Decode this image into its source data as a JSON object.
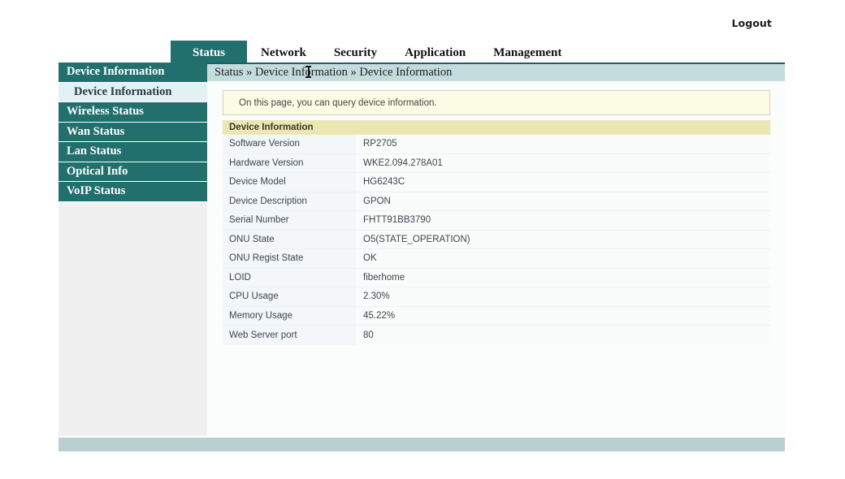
{
  "page": {
    "title": "Device Information",
    "logout_label": "Logout"
  },
  "nav": {
    "tabs": [
      {
        "label": "Status",
        "active": true
      },
      {
        "label": "Network",
        "active": false
      },
      {
        "label": "Security",
        "active": false
      },
      {
        "label": "Application",
        "active": false
      },
      {
        "label": "Management",
        "active": false
      }
    ]
  },
  "sidebar": {
    "items": [
      {
        "label": "Device Information",
        "type": "group",
        "active": false
      },
      {
        "label": "Device Information",
        "type": "sub",
        "active": true
      },
      {
        "label": "Wireless Status",
        "type": "group",
        "active": false
      },
      {
        "label": "Wan Status",
        "type": "group",
        "active": false
      },
      {
        "label": "Lan Status",
        "type": "group",
        "active": false
      },
      {
        "label": "Optical Info",
        "type": "group",
        "active": false
      },
      {
        "label": "VoIP Status",
        "type": "group",
        "active": false
      }
    ]
  },
  "breadcrumb": {
    "text": "Status » Device Information » Device Information"
  },
  "notice": {
    "text": "On this page, you can query device information."
  },
  "table": {
    "header": "Device Information",
    "rows": [
      {
        "label": "Software Version",
        "value": "RP2705"
      },
      {
        "label": "Hardware Version",
        "value": "WKE2.094.278A01"
      },
      {
        "label": "Device Model",
        "value": "HG6243C"
      },
      {
        "label": "Device Description",
        "value": "GPON"
      },
      {
        "label": "Serial Number",
        "value": "FHTT91BB3790"
      },
      {
        "label": "ONU State",
        "value": "O5(STATE_OPERATION)"
      },
      {
        "label": "ONU Regist State",
        "value": "OK"
      },
      {
        "label": "LOID",
        "value": "fiberhome"
      },
      {
        "label": "CPU Usage",
        "value": "2.30%"
      },
      {
        "label": "Memory Usage",
        "value": "45.22%"
      },
      {
        "label": "Web Server port",
        "value": "80"
      }
    ]
  },
  "colors": {
    "teal": "#21706e",
    "breadcrumb_bar": "#c5dcdf",
    "notice_bg": "#fcfbe3",
    "table_header_bg": "#ece7b2",
    "sidebar_sub_bg": "#e3f0f4",
    "footer_bg": "#b9cfd2"
  }
}
